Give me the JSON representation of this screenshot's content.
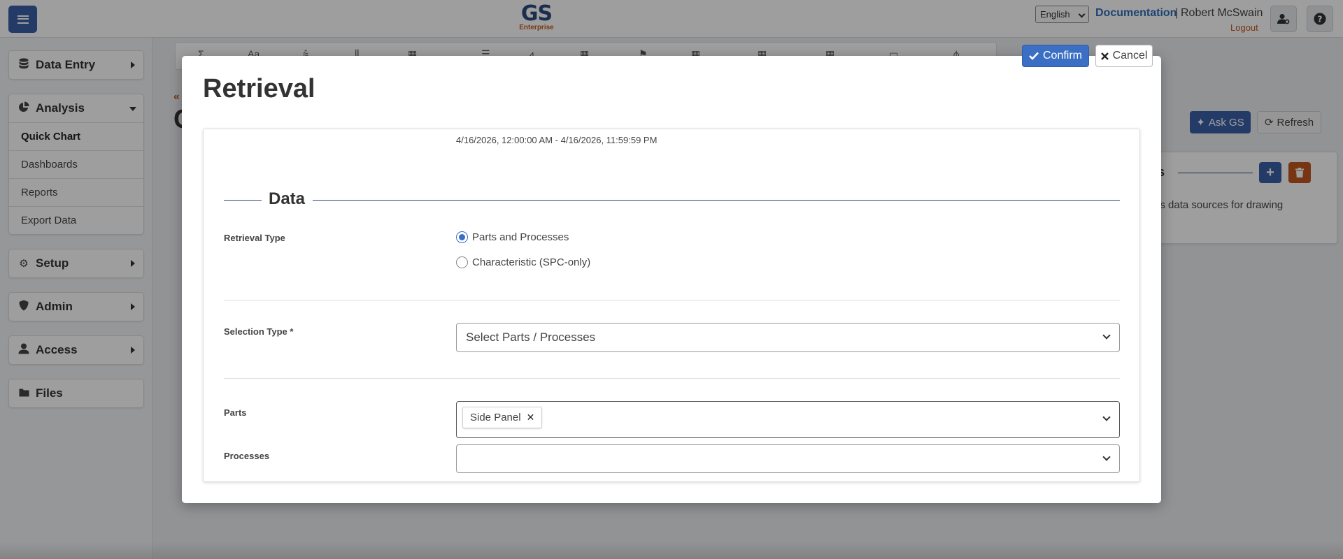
{
  "header": {
    "logo_main": "GS",
    "logo_sub": "Enterprise",
    "language": "English",
    "documentation": "Documentation",
    "separator": "|",
    "user": "Robert McSwain",
    "logout": "Logout"
  },
  "sidebar": {
    "data_entry": "Data Entry",
    "analysis": "Analysis",
    "analysis_items": [
      "Quick Chart",
      "Dashboards",
      "Reports",
      "Export Data"
    ],
    "setup": "Setup",
    "admin": "Admin",
    "access": "Access",
    "files": "Files"
  },
  "background": {
    "toolbar_icons": [
      "Σ",
      "Aa",
      "⩯",
      "⫼",
      "▦",
      "☰",
      "⩘",
      "▦",
      "⚑",
      "▦",
      "▦",
      "▦",
      "▭",
      "⫛"
    ],
    "back_chevron": "«",
    "title_fragment": "C",
    "ask_gs": "Ask GS",
    "refresh": "Refresh",
    "card_title_fragment": "ls",
    "card_add": "+",
    "card_text_fragment": "as data sources for drawing"
  },
  "modal": {
    "title": "Retrieval",
    "confirm": "Confirm",
    "cancel": "Cancel",
    "date_range": "4/16/2026, 12:00:00 AM - 4/16/2026, 11:59:59 PM",
    "section_title": "Data",
    "retrieval_type_label": "Retrieval Type",
    "retrieval_options": [
      "Parts and Processes",
      "Characteristic (SPC-only)"
    ],
    "selected_retrieval": 0,
    "selection_type_label": "Selection Type *",
    "selection_type_value": "Select Parts / Processes",
    "parts_label": "Parts",
    "parts_selected": [
      "Side Panel"
    ],
    "processes_label": "Processes"
  },
  "colors": {
    "primary": "#3a5fa8",
    "accent": "#c0571f",
    "link": "#2f6fb8"
  }
}
